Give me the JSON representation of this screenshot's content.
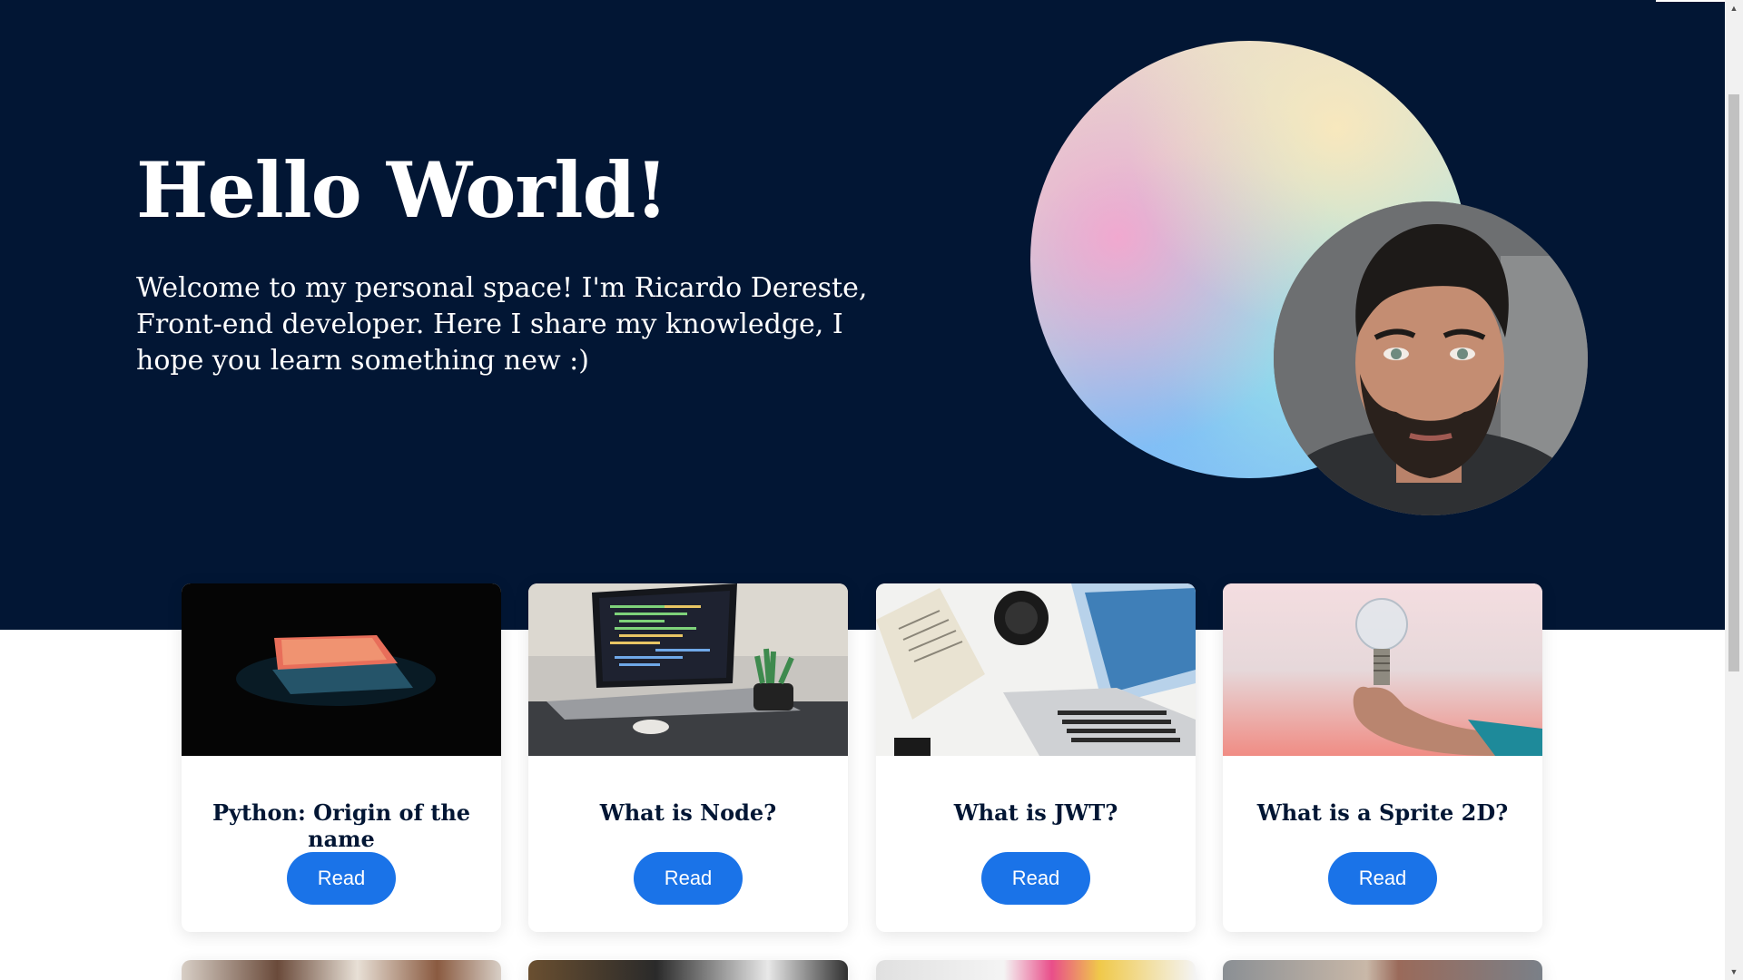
{
  "hero": {
    "title": "Hello World!",
    "text": "Welcome to my personal space! I'm Ricardo Dereste, Front-end developer. Here I share my knowledge, I hope you learn something new :)"
  },
  "posts": [
    {
      "title": "Python: Origin of the name",
      "button": "Read"
    },
    {
      "title": "What is Node?",
      "button": "Read"
    },
    {
      "title": "What is JWT?",
      "button": "Read"
    },
    {
      "title": "What is a Sprite 2D?",
      "button": "Read"
    }
  ],
  "colors": {
    "hero_background": "#021634",
    "button": "#1a73e8",
    "card_title": "#021634"
  },
  "icons": {
    "scroll_up": "scroll-up-arrow-icon",
    "scroll_down": "scroll-down-arrow-icon"
  }
}
